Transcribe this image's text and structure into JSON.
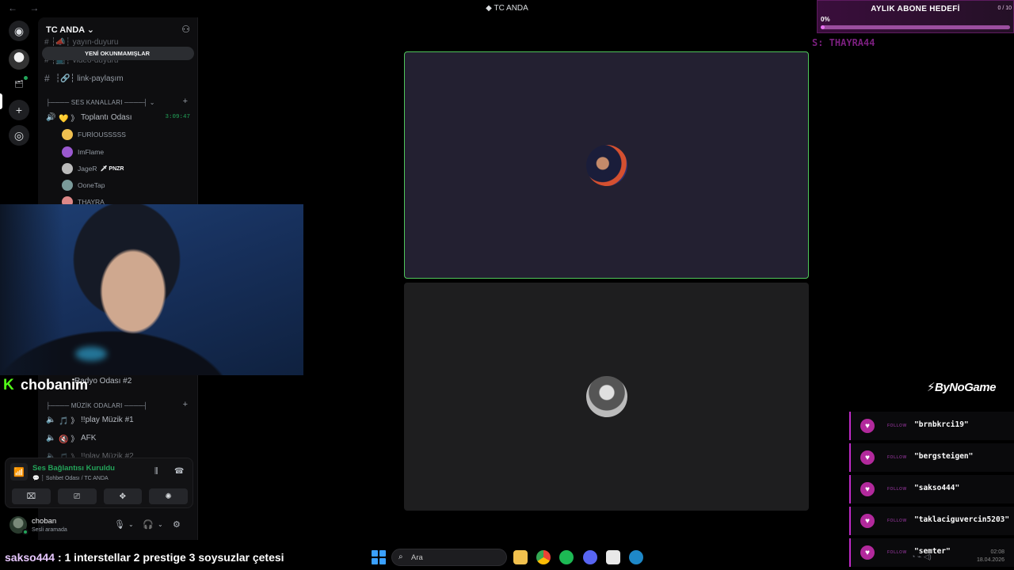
{
  "window": {
    "nav_arrows": "← →",
    "server_title": "TC ANDA"
  },
  "server_rail": {
    "discord_icon": "discord-logo-icon",
    "add_icon": "plus-icon",
    "explore_icon": "compass-icon"
  },
  "guild": {
    "name": "TC ANDA ⌄",
    "invite_icon": "invite-member-icon"
  },
  "unread_banner": "YENİ OKUNMAMIŞLAR",
  "text_channels": [
    {
      "name": "yayın-duyuru",
      "prefix": "# ┆📣┆"
    },
    {
      "name": "video-duyuru",
      "prefix": "# ┆📺┆"
    },
    {
      "name": "link-paylaşım",
      "prefix": "┆🔗┆"
    }
  ],
  "categories": {
    "voice": "├──── SES KANALLARI ────┤ ⌄",
    "music": "├──── MÜZİK ODALARI ────┤"
  },
  "voice_channels": [
    {
      "name": "Toplantı Odası",
      "icon": "💛 》",
      "timer": "3:09:47"
    },
    {
      "name": "Radyo Odası #2",
      "icon": ""
    }
  ],
  "voice_members": [
    {
      "name": "FURİOUSSSSS",
      "color": "#f0c050"
    },
    {
      "name": "ImFlame",
      "color": "#9b59d0"
    },
    {
      "name": "JageR",
      "tag": "🗡 PNZR",
      "color": "#bbbbbb"
    },
    {
      "name": "OoneTap",
      "color": "#8aa"
    },
    {
      "name": "THAYRA",
      "color": "#d88"
    }
  ],
  "music_channels": [
    {
      "name": "!!play Müzik #1",
      "icon": "🎵 》"
    },
    {
      "name": "AFK",
      "icon": "🔇 》"
    },
    {
      "name": "!!play Müzik #2",
      "icon": "🎵 》"
    }
  ],
  "rtc": {
    "status": "Ses Bağlantısı Kuruldu",
    "location": "💬 ┆ Sohbet Odası / TC ANDA",
    "buttons": [
      "camera-off-icon",
      "screen-share-icon",
      "activities-icon",
      "soundboard-icon"
    ]
  },
  "user": {
    "name": "choban",
    "status": "Sesli aramada"
  },
  "streamer": {
    "platform_glyph": "K",
    "name": "chobanim"
  },
  "sub_goal": {
    "title": "AYLIK ABONE HEDEFİ",
    "count": "0 / 10",
    "percent": "0%",
    "progress": 0.02
  },
  "sub_ticker": "S: THAYRA44",
  "brand": "ByNoGame",
  "follow_feed": {
    "label": "FOLLOW",
    "users": [
      "\"brnbkrci19\"",
      "\"bergsteigen\"",
      "\"sakso444\"",
      "\"taklaciguvercin5203\"",
      "\"semter\""
    ]
  },
  "chat_ticker": {
    "user": "sakso444",
    "message": " : 1 interstellar 2 prestige 3 soysuzlar çetesi"
  },
  "taskbar": {
    "search_placeholder": "Ara",
    "apps": [
      "file-explorer-icon",
      "chrome-icon",
      "spotify-icon",
      "discord-icon",
      "notepad-icon",
      "edge-icon"
    ],
    "time": "02:08",
    "date": "18.04.2026"
  },
  "colors": {
    "accent_green": "#23a55a",
    "speaking_border": "#4fc55a",
    "goal_purple": "#e76ff0",
    "kick_green": "#53fc18"
  }
}
